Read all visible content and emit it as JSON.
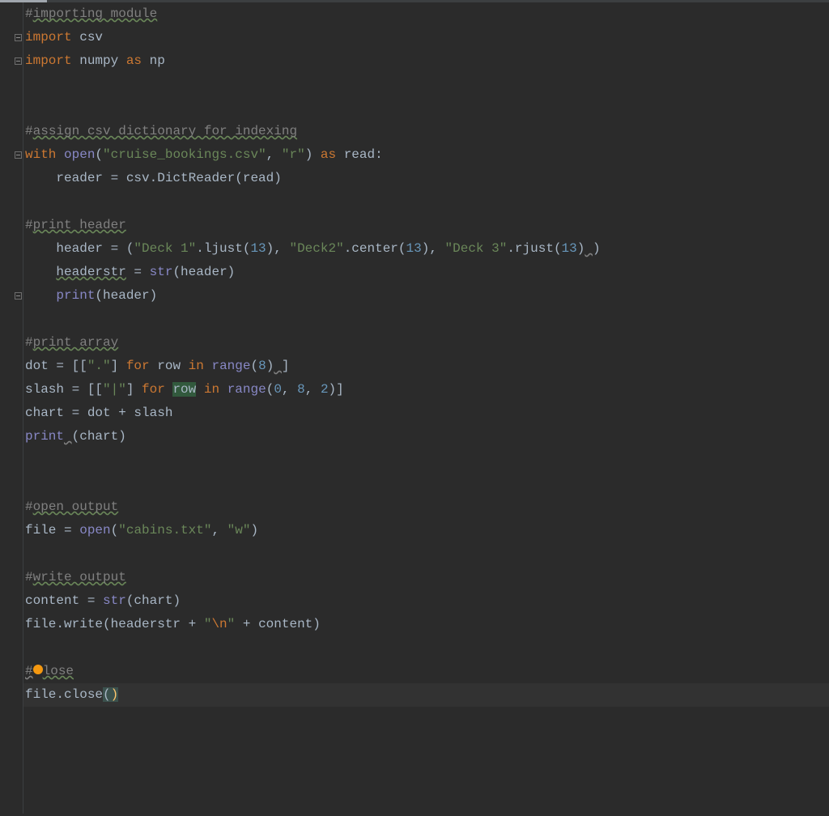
{
  "colors": {
    "background": "#2b2b2b",
    "gutter_border": "#3c3f41",
    "keyword": "#cc7832",
    "string": "#6a8759",
    "number": "#6897bb",
    "comment": "#808080",
    "builtin": "#8888c6",
    "text": "#a9b7c6",
    "caret_bg": "#3b514d",
    "caret_fg": "#ffc66d",
    "occurrence": "#32593d"
  },
  "caret_position": {
    "line_index": 29,
    "inside_parens": true
  },
  "highlighted_word": "row",
  "lines": [
    {
      "i": 0,
      "indent": 0,
      "tokens": [
        {
          "t": "#",
          "c": "cmt"
        },
        {
          "t": "importing module",
          "c": "cmt typo"
        }
      ]
    },
    {
      "i": 1,
      "indent": 0,
      "tokens": [
        {
          "t": "import",
          "c": "kw"
        },
        {
          "t": " ",
          "c": ""
        },
        {
          "t": "csv",
          "c": "ident"
        }
      ]
    },
    {
      "i": 2,
      "indent": 0,
      "tokens": [
        {
          "t": "import",
          "c": "kw"
        },
        {
          "t": " numpy ",
          "c": "ident"
        },
        {
          "t": "as",
          "c": "kw"
        },
        {
          "t": " np",
          "c": "ident"
        }
      ]
    },
    {
      "i": 3,
      "indent": 0,
      "tokens": []
    },
    {
      "i": 4,
      "indent": 0,
      "tokens": []
    },
    {
      "i": 5,
      "indent": 0,
      "tokens": [
        {
          "t": "#",
          "c": "cmt"
        },
        {
          "t": "assign csv dictionary for indexing",
          "c": "cmt typo"
        }
      ]
    },
    {
      "i": 6,
      "indent": 0,
      "tokens": [
        {
          "t": "with",
          "c": "kw"
        },
        {
          "t": " ",
          "c": ""
        },
        {
          "t": "open",
          "c": "builtin"
        },
        {
          "t": "(",
          "c": "op"
        },
        {
          "t": "\"cruise_bookings.csv\"",
          "c": "str"
        },
        {
          "t": ", ",
          "c": "op"
        },
        {
          "t": "\"r\"",
          "c": "str"
        },
        {
          "t": ") ",
          "c": "op"
        },
        {
          "t": "as",
          "c": "kw"
        },
        {
          "t": " read:",
          "c": "ident"
        }
      ]
    },
    {
      "i": 7,
      "indent": 1,
      "tokens": [
        {
          "t": "reader = csv.DictReader(read)",
          "c": "ident"
        }
      ]
    },
    {
      "i": 8,
      "indent": 0,
      "tokens": []
    },
    {
      "i": 9,
      "indent": 0,
      "tokens": [
        {
          "t": "#",
          "c": "cmt"
        },
        {
          "t": "print header",
          "c": "cmt typo"
        }
      ]
    },
    {
      "i": 10,
      "indent": 1,
      "tokens": [
        {
          "t": "header = (",
          "c": "ident"
        },
        {
          "t": "\"Deck 1\"",
          "c": "str"
        },
        {
          "t": ".ljust(",
          "c": "ident"
        },
        {
          "t": "13",
          "c": "num"
        },
        {
          "t": ")",
          "c": "op"
        },
        {
          "t": ", ",
          "c": "op"
        },
        {
          "t": "\"Deck2\"",
          "c": "str"
        },
        {
          "t": ".center(",
          "c": "ident"
        },
        {
          "t": "13",
          "c": "num"
        },
        {
          "t": ")",
          "c": "op"
        },
        {
          "t": ", ",
          "c": "op"
        },
        {
          "t": "\"Deck 3\"",
          "c": "str"
        },
        {
          "t": ".rjust(",
          "c": "ident"
        },
        {
          "t": "13",
          "c": "num"
        },
        {
          "t": ")",
          "c": "op"
        },
        {
          "t": " ",
          "c": "warn"
        },
        {
          "t": ")",
          "c": "op"
        }
      ]
    },
    {
      "i": 11,
      "indent": 1,
      "tokens": [
        {
          "t": "headerstr",
          "c": "ident typo"
        },
        {
          "t": " = ",
          "c": "op"
        },
        {
          "t": "str",
          "c": "builtin"
        },
        {
          "t": "(header)",
          "c": "ident"
        }
      ]
    },
    {
      "i": 12,
      "indent": 1,
      "tokens": [
        {
          "t": "print",
          "c": "builtin"
        },
        {
          "t": "(header)",
          "c": "ident"
        }
      ]
    },
    {
      "i": 13,
      "indent": 0,
      "tokens": []
    },
    {
      "i": 14,
      "indent": 0,
      "tokens": [
        {
          "t": "#",
          "c": "cmt"
        },
        {
          "t": "print array",
          "c": "cmt typo"
        }
      ]
    },
    {
      "i": 15,
      "indent": 0,
      "tokens": [
        {
          "t": "dot = [[",
          "c": "ident"
        },
        {
          "t": "\".\"",
          "c": "str"
        },
        {
          "t": "] ",
          "c": "op"
        },
        {
          "t": "for",
          "c": "kw"
        },
        {
          "t": " row ",
          "c": "ident"
        },
        {
          "t": "in",
          "c": "kw"
        },
        {
          "t": " ",
          "c": ""
        },
        {
          "t": "range",
          "c": "builtin"
        },
        {
          "t": "(",
          "c": "op"
        },
        {
          "t": "8",
          "c": "num"
        },
        {
          "t": ")",
          "c": "op"
        },
        {
          "t": " ",
          "c": "warn"
        },
        {
          "t": "]",
          "c": "op"
        }
      ]
    },
    {
      "i": 16,
      "indent": 0,
      "tokens": [
        {
          "t": "slash = [[",
          "c": "ident"
        },
        {
          "t": "\"|\"",
          "c": "str"
        },
        {
          "t": "] ",
          "c": "op"
        },
        {
          "t": "for",
          "c": "kw"
        },
        {
          "t": " ",
          "c": ""
        },
        {
          "t": "row",
          "c": "ident",
          "sel": true
        },
        {
          "t": " ",
          "c": ""
        },
        {
          "t": "in",
          "c": "kw"
        },
        {
          "t": " ",
          "c": ""
        },
        {
          "t": "range",
          "c": "builtin"
        },
        {
          "t": "(",
          "c": "op"
        },
        {
          "t": "0",
          "c": "num"
        },
        {
          "t": ", ",
          "c": "op"
        },
        {
          "t": "8",
          "c": "num"
        },
        {
          "t": ", ",
          "c": "op"
        },
        {
          "t": "2",
          "c": "num"
        },
        {
          "t": ")]",
          "c": "op"
        }
      ]
    },
    {
      "i": 17,
      "indent": 0,
      "tokens": [
        {
          "t": "chart = dot + slash",
          "c": "ident"
        }
      ]
    },
    {
      "i": 18,
      "indent": 0,
      "tokens": [
        {
          "t": "print",
          "c": "builtin"
        },
        {
          "t": " ",
          "c": "warn"
        },
        {
          "t": "(chart)",
          "c": "ident"
        }
      ]
    },
    {
      "i": 19,
      "indent": 0,
      "tokens": []
    },
    {
      "i": 20,
      "indent": 0,
      "tokens": []
    },
    {
      "i": 21,
      "indent": 0,
      "tokens": [
        {
          "t": "#",
          "c": "cmt"
        },
        {
          "t": "open output",
          "c": "cmt typo"
        }
      ]
    },
    {
      "i": 22,
      "indent": 0,
      "tokens": [
        {
          "t": "file = ",
          "c": "ident"
        },
        {
          "t": "open",
          "c": "builtin"
        },
        {
          "t": "(",
          "c": "op"
        },
        {
          "t": "\"cabins.txt\"",
          "c": "str"
        },
        {
          "t": ", ",
          "c": "op"
        },
        {
          "t": "\"w\"",
          "c": "str"
        },
        {
          "t": ")",
          "c": "op"
        }
      ]
    },
    {
      "i": 23,
      "indent": 0,
      "tokens": []
    },
    {
      "i": 24,
      "indent": 0,
      "tokens": [
        {
          "t": "#",
          "c": "cmt"
        },
        {
          "t": "write output",
          "c": "cmt typo"
        }
      ]
    },
    {
      "i": 25,
      "indent": 0,
      "tokens": [
        {
          "t": "content = ",
          "c": "ident"
        },
        {
          "t": "str",
          "c": "builtin"
        },
        {
          "t": "(chart)",
          "c": "ident"
        }
      ]
    },
    {
      "i": 26,
      "indent": 0,
      "tokens": [
        {
          "t": "file.write(headerstr + ",
          "c": "ident"
        },
        {
          "t": "\"",
          "c": "str"
        },
        {
          "t": "\\n",
          "c": "escape"
        },
        {
          "t": "\"",
          "c": "str"
        },
        {
          "t": " + content)",
          "c": "ident"
        }
      ]
    },
    {
      "i": 27,
      "indent": 0,
      "tokens": []
    },
    {
      "i": 28,
      "indent": 0,
      "tokens": [
        {
          "t": "#",
          "c": "cmt warn"
        },
        {
          "t": "CARET_DOT",
          "c": "caret-dot"
        },
        {
          "t": "lose",
          "c": "cmt typo"
        }
      ]
    },
    {
      "i": 29,
      "indent": 0,
      "highlight": true,
      "tokens": [
        {
          "t": "file.close",
          "c": "ident"
        },
        {
          "t": "(",
          "c": "caret-match op"
        },
        {
          "t": ")",
          "c": "caret-bg"
        }
      ]
    }
  ],
  "fold_markers": [
    {
      "top_line": 1,
      "kind": "minus"
    },
    {
      "top_line": 2,
      "kind": "minus"
    },
    {
      "top_line": 6,
      "kind": "minus"
    },
    {
      "top_line": 12,
      "kind": "minus"
    }
  ],
  "fold_lines": [
    {
      "from_line": 2,
      "height_lines": 0
    }
  ]
}
